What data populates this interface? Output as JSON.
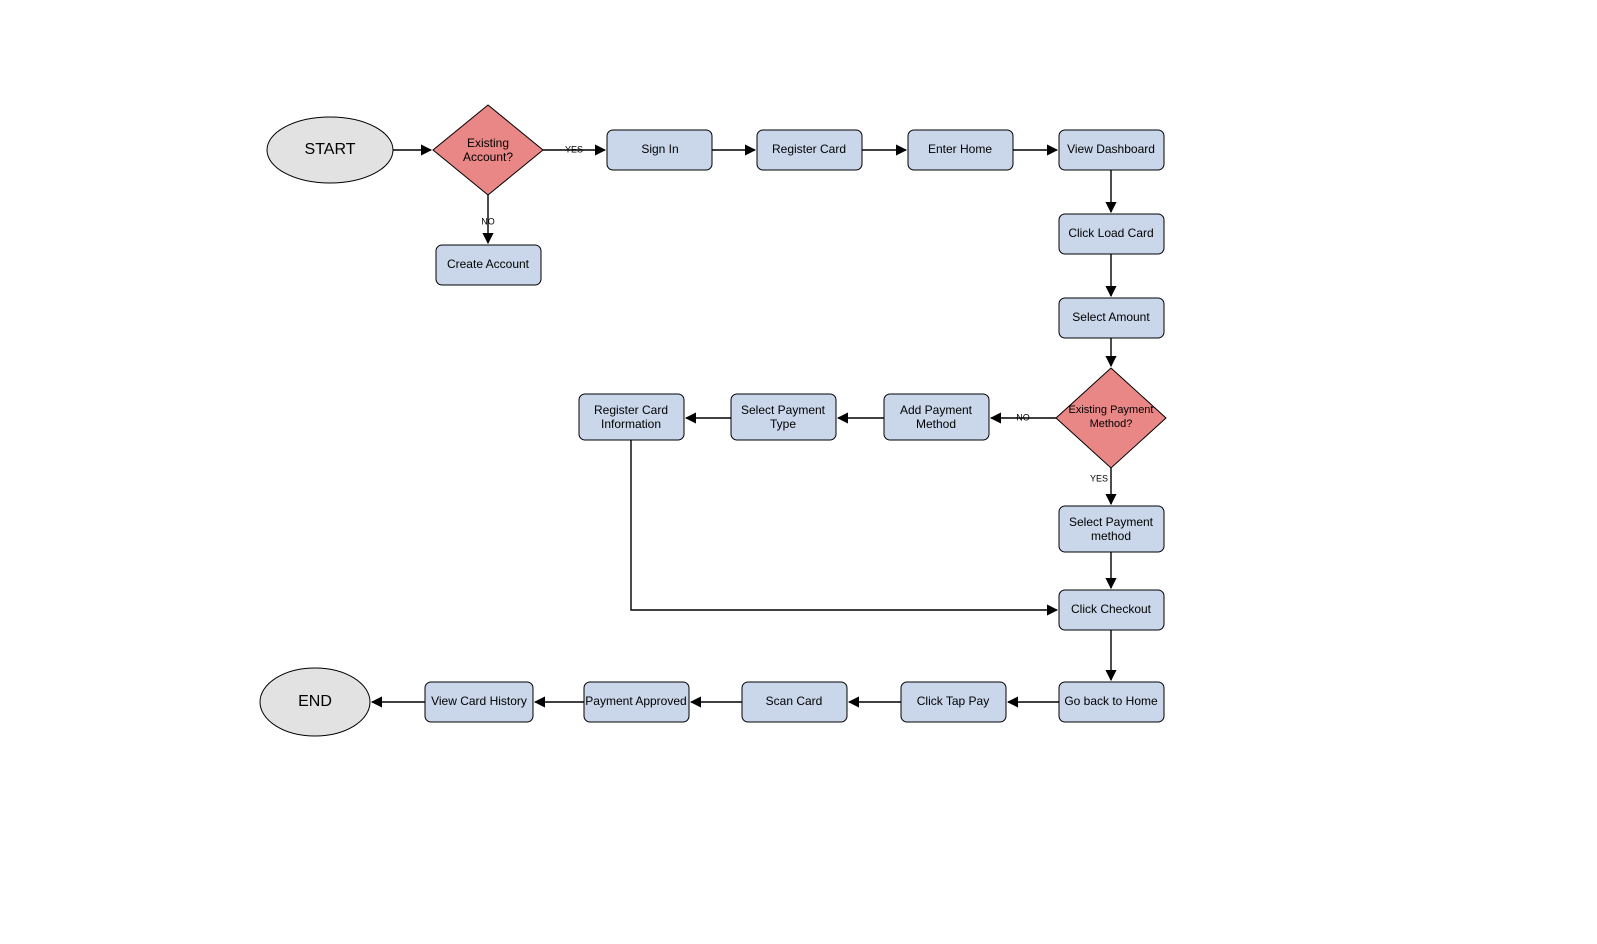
{
  "diagram": {
    "nodes": {
      "start": "START",
      "end": "END",
      "existing_account": "Existing Account?",
      "create_account": "Create Account",
      "sign_in": "Sign In",
      "register_card": "Register Card",
      "enter_home": "Enter Home",
      "view_dashboard": "View Dashboard",
      "click_load_card": "Click Load Card",
      "select_amount": "Select Amount",
      "existing_payment": "Existing Payment Method?",
      "add_payment_method": "Add Payment Method",
      "select_payment_type": "Select Payment Type",
      "register_card_info": "Register Card Information",
      "select_payment_method": "Select Payment method",
      "click_checkout": "Click Checkout",
      "go_back_home": "Go back to Home",
      "click_tap_pay": "Click Tap Pay",
      "scan_card": "Scan Card",
      "payment_approved": "Payment Approved",
      "view_card_history": "View Card History"
    },
    "edge_labels": {
      "yes": "YES",
      "no": "NO"
    }
  }
}
